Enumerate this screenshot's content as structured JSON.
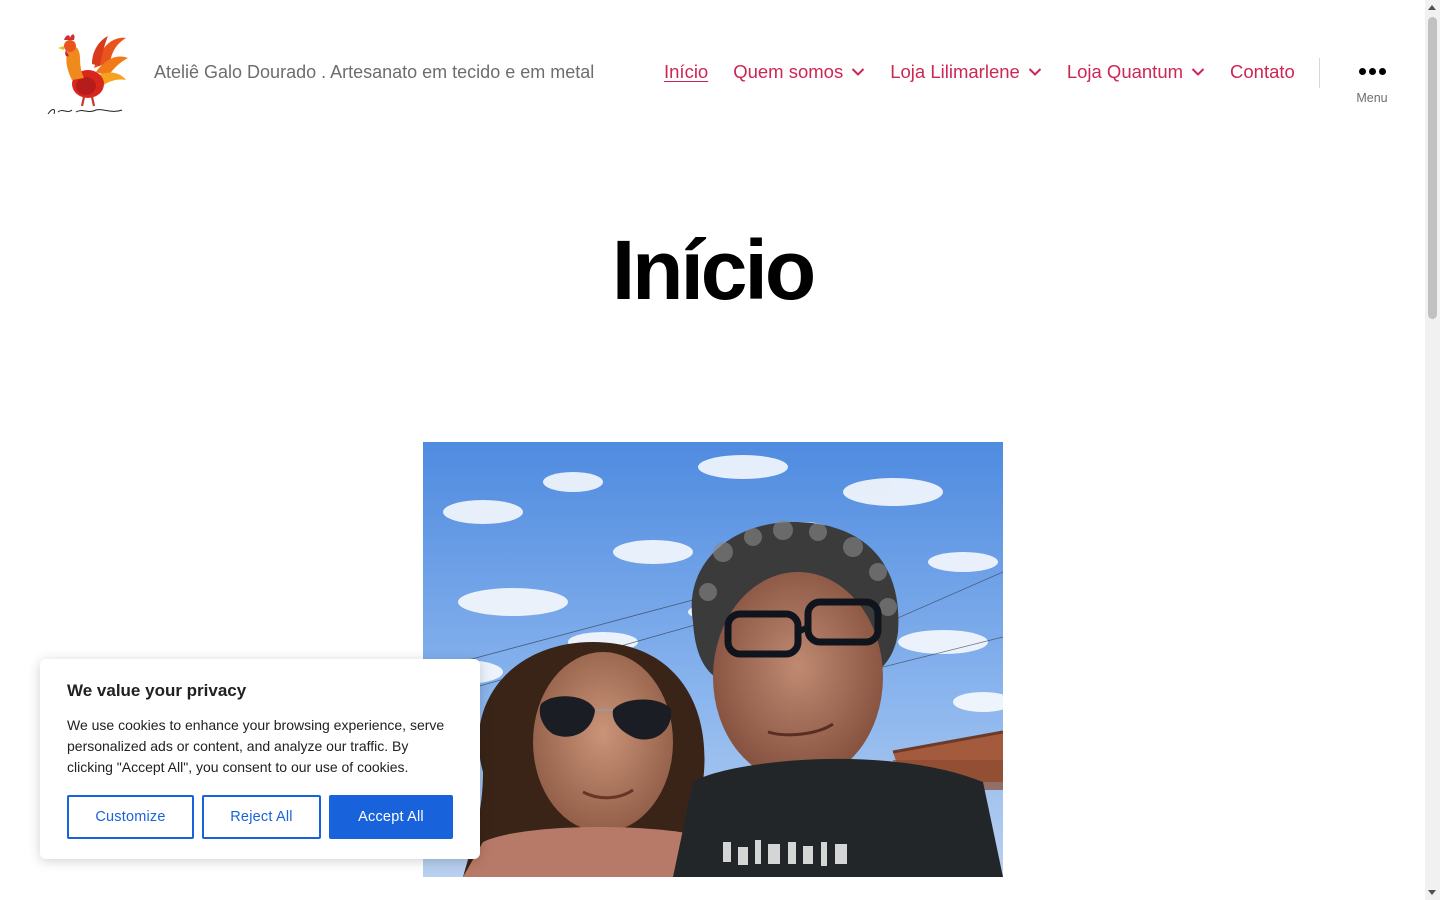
{
  "header": {
    "logo_text": "Ateliê GaloDourado",
    "tagline": "Ateliê Galo Dourado . Artesanato em tecido e em metal",
    "nav": [
      {
        "label": "Início",
        "has_dropdown": false,
        "current": true
      },
      {
        "label": "Quem somos",
        "has_dropdown": true,
        "current": false
      },
      {
        "label": "Loja Lilimarlene",
        "has_dropdown": true,
        "current": false
      },
      {
        "label": "Loja Quantum",
        "has_dropdown": true,
        "current": false
      },
      {
        "label": "Contato",
        "has_dropdown": false,
        "current": false
      }
    ],
    "menu_label": "Menu",
    "menu_icon": "ellipsis-icon"
  },
  "main": {
    "title": "Início"
  },
  "cookie_banner": {
    "title": "We value your privacy",
    "text": "We use cookies to enhance your browsing experience, serve personalized ads or content, and analyze our traffic. By clicking \"Accept All\", you consent to our use of cookies.",
    "customize_label": "Customize",
    "reject_label": "Reject All",
    "accept_label": "Accept All"
  },
  "colors": {
    "accent": "#cd2653",
    "cookie_button": "#1863dc",
    "muted_text": "#6d6d6d"
  }
}
